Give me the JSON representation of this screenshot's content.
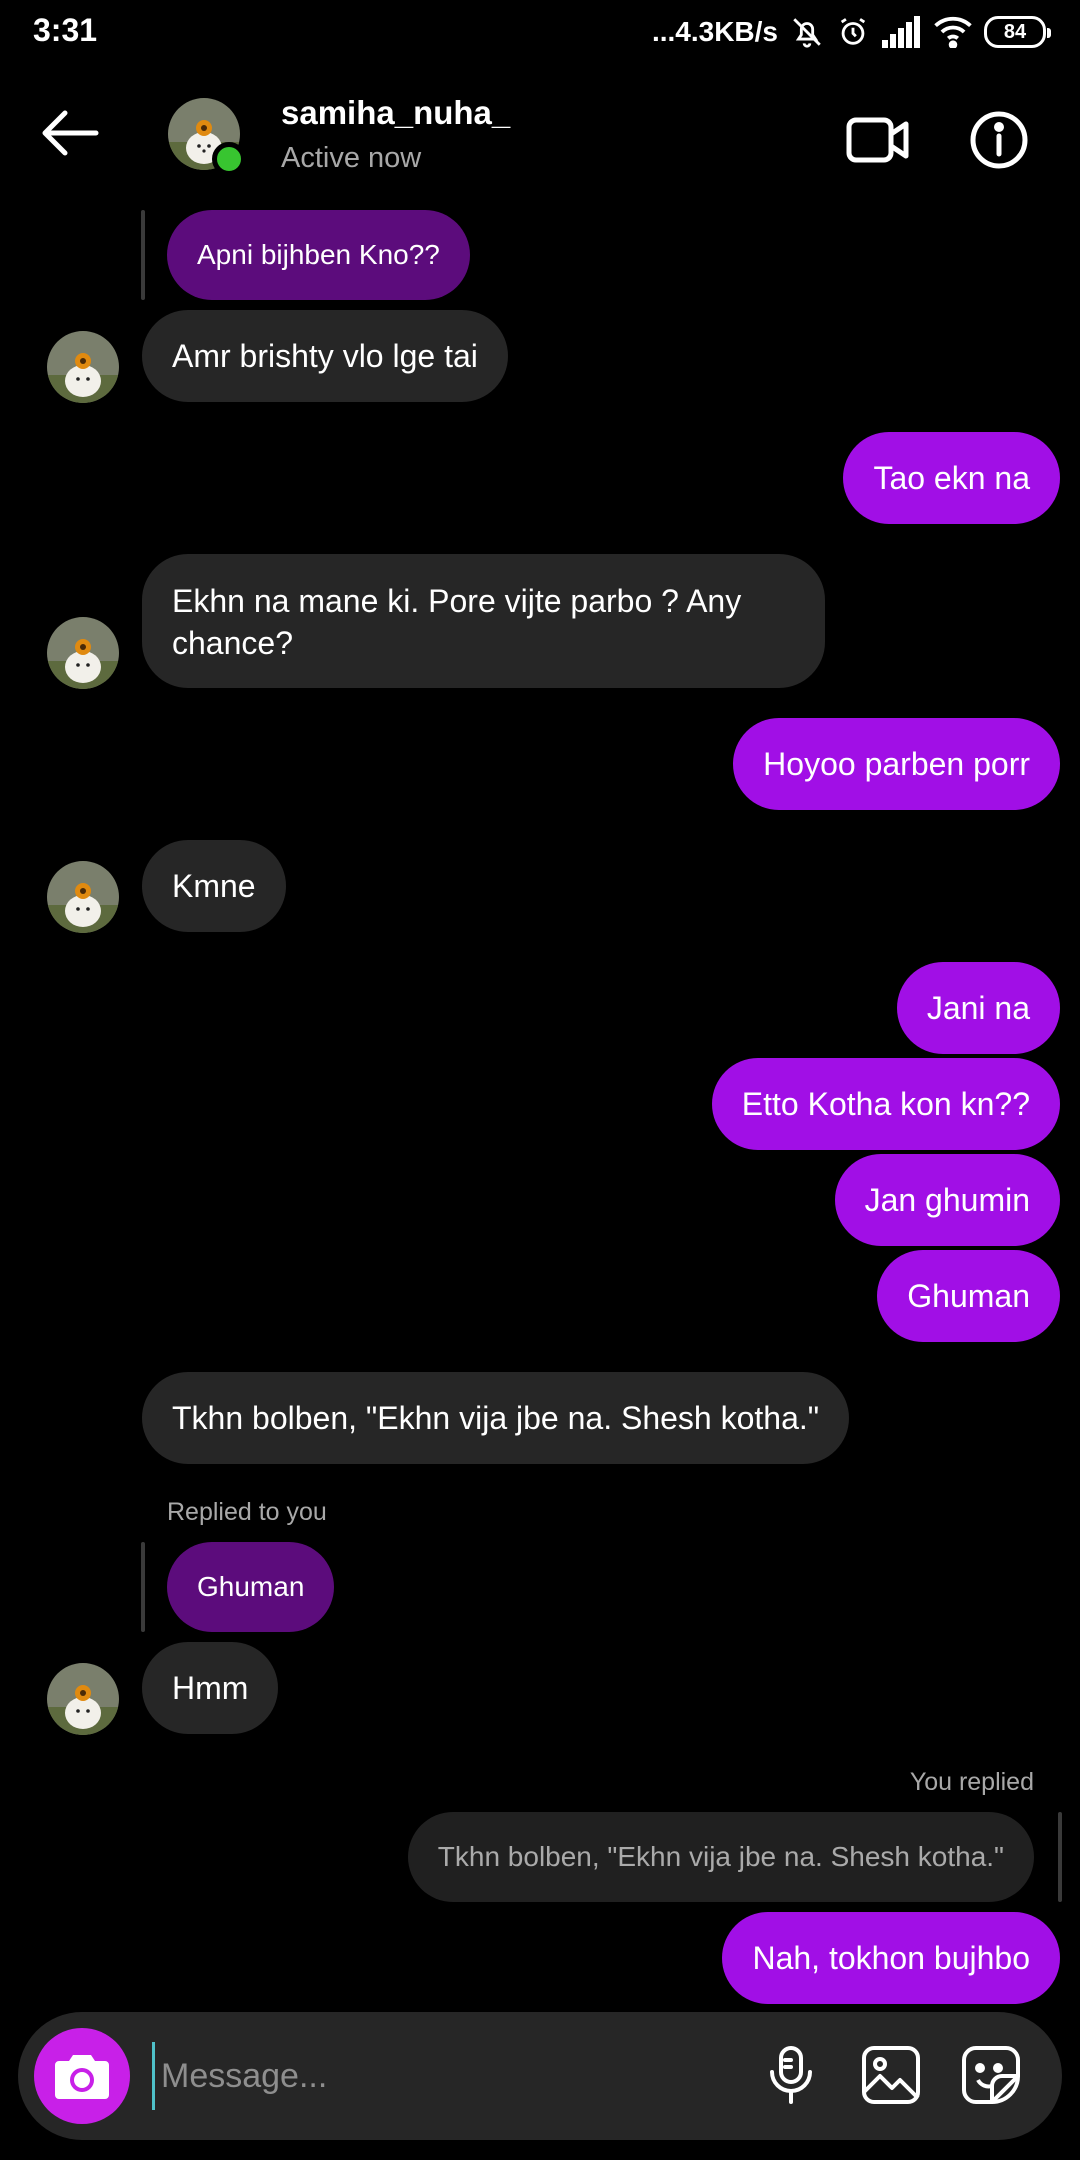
{
  "status_bar": {
    "time": "3:31",
    "net_speed": "...4.3KB/s",
    "battery": "84"
  },
  "header": {
    "username": "samiha_nuha_",
    "status": "Active now",
    "online_color": "#38c530"
  },
  "messages": [
    {
      "side": "in",
      "type": "reply-quote",
      "text": "Apni bijhben Kno??"
    },
    {
      "side": "in",
      "text": "Amr brishty vlo lge tai"
    },
    {
      "side": "out",
      "text": "Tao ekn na"
    },
    {
      "side": "in",
      "text": "Ekhn na mane ki. Pore vijte parbo ? Any chance?"
    },
    {
      "side": "out",
      "text": "Hoyoo parben porr"
    },
    {
      "side": "in",
      "text": "Kmne"
    },
    {
      "side": "out",
      "text": "Jani na"
    },
    {
      "side": "out",
      "text": "Etto Kotha kon kn??"
    },
    {
      "side": "out",
      "text": "Jan ghumin"
    },
    {
      "side": "out",
      "text": "Ghuman"
    },
    {
      "side": "in",
      "text": "Tkhn bolben, \"Ekhn vija jbe na. Shesh kotha.\""
    },
    {
      "side": "in",
      "type": "reply-label",
      "text": "Replied to you"
    },
    {
      "side": "in",
      "type": "reply-quote",
      "text": "Ghuman"
    },
    {
      "side": "in",
      "text": "Hmm"
    },
    {
      "side": "out",
      "type": "reply-label",
      "text": "You replied"
    },
    {
      "side": "out",
      "type": "reply-quote",
      "text": "Tkhn bolben, \"Ekhn vija jbe na. Shesh kotha.\""
    },
    {
      "side": "out",
      "text": "Nah, tokhon bujhbo"
    }
  ],
  "composer": {
    "placeholder": "Message..."
  },
  "colors": {
    "outgoing_bubble": "#a10fe6",
    "incoming_bubble": "#262626",
    "reply_quote": "#5c0c7c",
    "camera_button": "#c820e8"
  },
  "icons": [
    "back-arrow-icon",
    "video-call-icon",
    "info-icon",
    "camera-icon",
    "microphone-icon",
    "gallery-icon",
    "sticker-icon"
  ]
}
